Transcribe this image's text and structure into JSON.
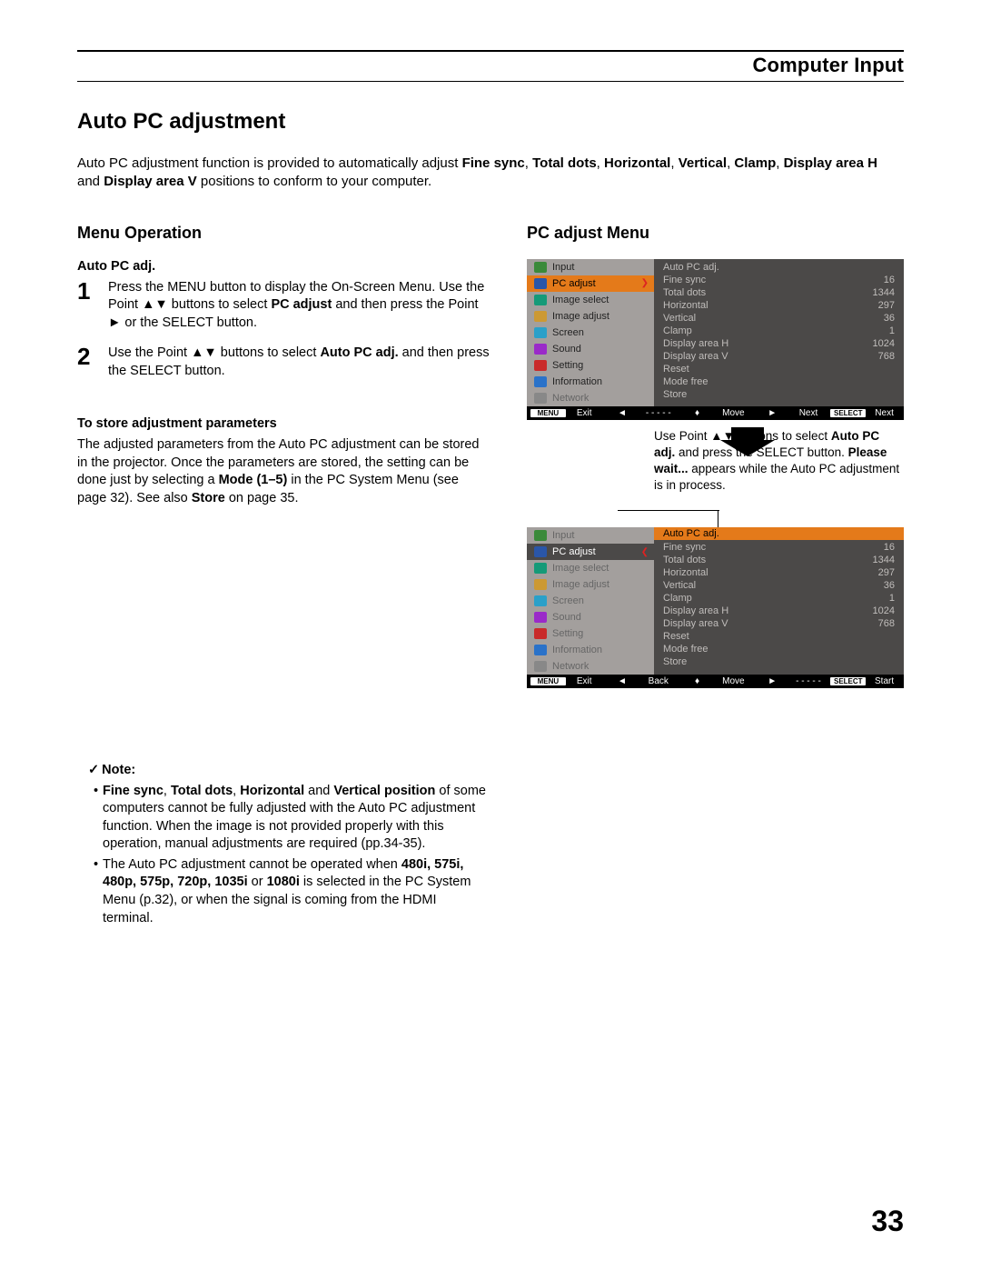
{
  "header": {
    "section": "Computer Input"
  },
  "title": "Auto PC adjustment",
  "intro": {
    "pre": "Auto PC adjustment function is provided to automatically adjust ",
    "bold1": "Fine sync",
    "s1": ", ",
    "bold2": "Total dots",
    "s2": ", ",
    "bold3": "Horizontal",
    "s3": ", ",
    "bold4": "Vertical",
    "s4": ", ",
    "bold5": "Clamp",
    "s5": ", ",
    "bold6": "Display area H",
    "s6": " and ",
    "bold7": "Display area V",
    "tail": " positions to conform to your computer."
  },
  "left": {
    "h2": "Menu Operation",
    "sub1": "Auto PC adj.",
    "step1": {
      "num": "1",
      "a": "Press the MENU button to display the On-Screen Menu. Use the Point ▲▼ buttons to select ",
      "b": "PC adjust",
      "c": " and then press the Point ► or the SELECT button."
    },
    "step2": {
      "num": "2",
      "a": "Use the Point ▲▼ buttons to select ",
      "b": "Auto PC adj.",
      "c": " and then press the SELECT button."
    },
    "storeH": "To store adjustment parameters",
    "store": {
      "a": "The adjusted parameters from the Auto PC adjustment can be stored in the projector. Once the parameters are stored, the setting can be done just by selecting a ",
      "b": "Mode (1–5)",
      "c": " in the PC System Menu (see page 32). See also ",
      "d": "Store",
      "e": " on page 35."
    },
    "noteTitle": "Note:",
    "check": "✓",
    "note1": {
      "a": "Fine sync",
      "s1": ", ",
      "b": "Total dots",
      "s2": ", ",
      "c": "Horizontal",
      "s3": " and ",
      "d": "Vertical position",
      "tail": " of some computers cannot be fully adjusted with the Auto PC adjustment function. When the image is not provided properly with this operation, manual adjustments are required (pp.34-35)."
    },
    "note2": {
      "a": "The Auto PC adjustment cannot be operated when ",
      "b": "480i, 575i, 480p, 575p, 720p, 1035i",
      "s": " or ",
      "c": "1080i",
      "tail": " is selected in the PC System Menu (p.32), or when the signal is coming from the HDMI terminal."
    }
  },
  "right": {
    "h2": "PC adjust Menu",
    "caption": {
      "a": "Use Point ▲▼ buttons to select ",
      "b": "Auto PC adj.",
      "c": " and press the SELECT button. ",
      "d": "Please wait...",
      "e": " appears while the Auto PC adjustment is in process."
    }
  },
  "menu": {
    "items": [
      {
        "label": "Input",
        "icon": "ic-in"
      },
      {
        "label": "PC adjust",
        "icon": "ic-pc"
      },
      {
        "label": "Image select",
        "icon": "ic-imgsel"
      },
      {
        "label": "Image adjust",
        "icon": "ic-imgadj"
      },
      {
        "label": "Screen",
        "icon": "ic-scr"
      },
      {
        "label": "Sound",
        "icon": "ic-snd"
      },
      {
        "label": "Setting",
        "icon": "ic-set"
      },
      {
        "label": "Information",
        "icon": "ic-info"
      },
      {
        "label": "Network",
        "icon": "ic-net"
      }
    ],
    "params": [
      {
        "name": "Auto PC adj.",
        "val": ""
      },
      {
        "name": "Fine sync",
        "val": "16"
      },
      {
        "name": "Total dots",
        "val": "1344"
      },
      {
        "name": "Horizontal",
        "val": "297"
      },
      {
        "name": "Vertical",
        "val": "36"
      },
      {
        "name": "Clamp",
        "val": "1"
      },
      {
        "name": "Display area H",
        "val": "1024"
      },
      {
        "name": "Display area V",
        "val": "768"
      },
      {
        "name": "Reset",
        "val": ""
      },
      {
        "name": "Mode free",
        "val": ""
      },
      {
        "name": "Store",
        "val": ""
      }
    ],
    "foot1": {
      "exitBox": "MENU",
      "exit": "Exit",
      "back": "- - - - -",
      "backSym": "◄",
      "move": "Move",
      "moveSym": "♦",
      "next": "Next",
      "nextSym": "►",
      "selBox": "SELECT",
      "sel": "Next"
    },
    "foot2": {
      "exitBox": "MENU",
      "exit": "Exit",
      "back": "Back",
      "backSym": "◄",
      "move": "Move",
      "moveSym": "♦",
      "next": "- - - - -",
      "nextSym": "►",
      "selBox": "SELECT",
      "sel": "Start"
    }
  },
  "pageNumber": "33"
}
